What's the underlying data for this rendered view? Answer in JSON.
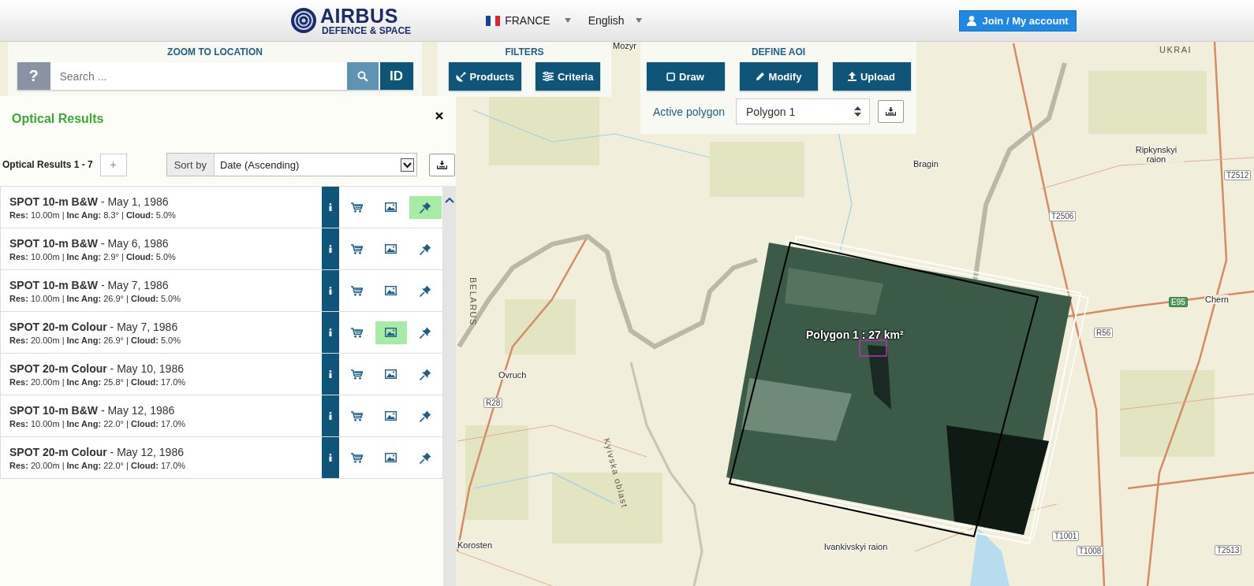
{
  "header": {
    "logo_name": "AIRBUS",
    "logo_subtitle": "DEFENCE & SPACE",
    "country": "FRANCE",
    "language": "English",
    "account_button": "Join / My account"
  },
  "zoom_to_location": {
    "title": "ZOOM TO LOCATION",
    "help_button": "?",
    "search": {
      "placeholder": "Search ..."
    },
    "id_button": "ID"
  },
  "filters": {
    "title": "FILTERS",
    "buttons": [
      {
        "label": "Products",
        "kind": "satellite"
      },
      {
        "label": "Criteria",
        "kind": "sliders"
      }
    ]
  },
  "define_aoi": {
    "title": "DEFINE AOI",
    "buttons": [
      {
        "label": "Draw",
        "kind": "square"
      },
      {
        "label": "Modify",
        "kind": "pencil"
      },
      {
        "label": "Upload",
        "kind": "upload"
      }
    ],
    "active_polygon_label": "Active polygon",
    "active_polygon_value": "Polygon 1"
  },
  "results_panel": {
    "title": "Optical Results",
    "count_label": "Optical Results 1 - 7",
    "add_button": "+",
    "sort_label": "Sort by",
    "sort_value": "Date (Ascending)",
    "items": [
      {
        "title": "**SPOT 10-m B&W** - May 1, 1986",
        "details": "**Res:** 10.00m | **Inc Ang:** 8.3° | **Cloud:** 5.0%",
        "preview_on": false,
        "pinned": true
      },
      {
        "title": "**SPOT 10-m B&W** - May 6, 1986",
        "details": "**Res:** 10.00m | **Inc Ang:** 2.9° | **Cloud:** 5.0%",
        "preview_on": false,
        "pinned": false
      },
      {
        "title": "**SPOT 10-m B&W** - May 7, 1986",
        "details": "**Res:** 10.00m | **Inc Ang:** 26.9° | **Cloud:** 5.0%",
        "preview_on": false,
        "pinned": false
      },
      {
        "title": "**SPOT 20-m Colour** - May 7, 1986",
        "details": "**Res:** 20.00m | **Inc Ang:** 26.9° | **Cloud:** 5.0%",
        "preview_on": true,
        "pinned": false
      },
      {
        "title": "**SPOT 20-m Colour** - May 10, 1986",
        "details": "**Res:** 20.00m | **Inc Ang:** 25.8° | **Cloud:** 17.0%",
        "preview_on": false,
        "pinned": false
      },
      {
        "title": "**SPOT 10-m B&W** - May 12, 1986",
        "details": "**Res:** 10.00m | **Inc Ang:** 22.0° | **Cloud:** 17.0%",
        "preview_on": false,
        "pinned": false
      },
      {
        "title": "**SPOT 20-m Colour** - May 12, 1986",
        "details": "**Res:** 20.00m | **Inc Ang:** 22.0° | **Cloud:** 17.0%",
        "preview_on": false,
        "pinned": false
      }
    ]
  },
  "map": {
    "polygon_label": "Polygon 1 : 27 km²",
    "labels": [
      {
        "text": "Mozyr",
        "kind": "place"
      },
      {
        "text": "UKRAI",
        "kind": "region"
      },
      {
        "text": "Bragin",
        "kind": "place"
      },
      {
        "text": "Ripkynskyi raion",
        "kind": "place"
      },
      {
        "text": "T2512",
        "kind": "road"
      },
      {
        "text": "T2506",
        "kind": "road"
      },
      {
        "text": "Chern",
        "kind": "place"
      },
      {
        "text": "E95",
        "kind": "euroroad"
      },
      {
        "text": "R56",
        "kind": "road"
      },
      {
        "text": "BELARUS",
        "kind": "region"
      },
      {
        "text": "Ovruch",
        "kind": "place"
      },
      {
        "text": "R28",
        "kind": "road"
      },
      {
        "text": "Kyivska oblast",
        "kind": "region"
      },
      {
        "text": "Korosten",
        "kind": "place"
      },
      {
        "text": "Ivankivskyi raion",
        "kind": "place"
      },
      {
        "text": "T1001",
        "kind": "road"
      },
      {
        "text": "T1008",
        "kind": "road"
      },
      {
        "text": "T2513",
        "kind": "road"
      }
    ]
  }
}
